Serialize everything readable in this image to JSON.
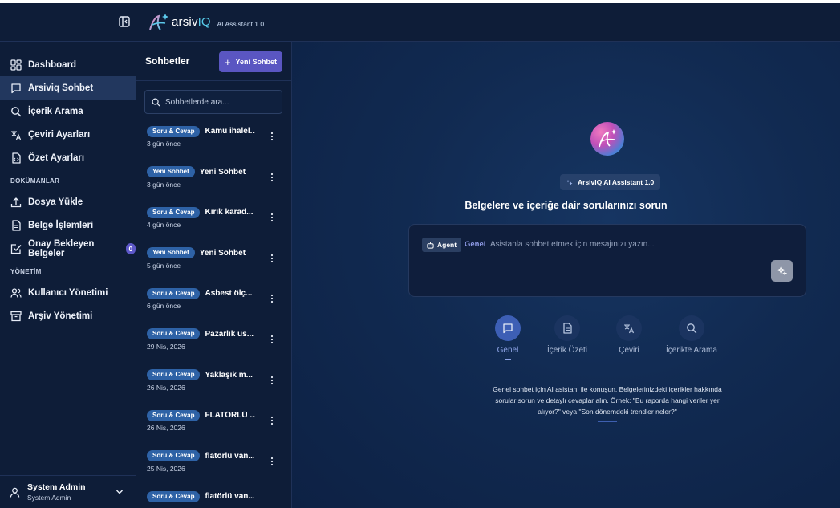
{
  "header": {
    "logo_word": "arsiv",
    "logo_iq": "IQ",
    "subtitle": "AI Assistant 1.0"
  },
  "sidebar": {
    "items": [
      {
        "label": "Dashboard",
        "icon": "dashboard-icon"
      },
      {
        "label": "Arsiviq Sohbet",
        "icon": "chat-icon",
        "active": true
      },
      {
        "label": "İçerik Arama",
        "icon": "search-icon"
      },
      {
        "label": "Çeviri Ayarları",
        "icon": "translate-icon"
      },
      {
        "label": "Özet Ayarları",
        "icon": "summary-icon"
      }
    ],
    "section_docs": "DOKÜMANLAR",
    "doc_items": [
      {
        "label": "Dosya Yükle",
        "icon": "upload-icon"
      },
      {
        "label": "Belge İşlemleri",
        "icon": "document-icon"
      },
      {
        "label": "Onay Bekleyen Belgeler",
        "icon": "approval-icon",
        "badge": "0"
      }
    ],
    "section_admin": "YÖNETİM",
    "admin_items": [
      {
        "label": "Kullanıcı Yönetimi",
        "icon": "users-icon"
      },
      {
        "label": "Arşiv Yönetimi",
        "icon": "archive-icon"
      }
    ],
    "user": {
      "name": "System Admin",
      "role": "System Admin"
    }
  },
  "chats": {
    "title": "Sohbetler",
    "new_label": "Yeni Sohbet",
    "search_placeholder": "Sohbetlerde ara...",
    "items": [
      {
        "tag": "Soru & Cevap",
        "title": "Kamu ihalel...",
        "date": "3 gün önce"
      },
      {
        "tag": "Yeni Sohbet",
        "title": "Yeni Sohbet",
        "date": "3 gün önce"
      },
      {
        "tag": "Soru & Cevap",
        "title": "Kırık karad...",
        "date": "4 gün önce"
      },
      {
        "tag": "Yeni Sohbet",
        "title": "Yeni Sohbet",
        "date": "5 gün önce"
      },
      {
        "tag": "Soru & Cevap",
        "title": "Asbest ölç...",
        "date": "6 gün önce"
      },
      {
        "tag": "Soru & Cevap",
        "title": "Pazarlık us...",
        "date": "29 Nis, 2026"
      },
      {
        "tag": "Soru & Cevap",
        "title": "Yaklaşık m...",
        "date": "26 Nis, 2026"
      },
      {
        "tag": "Soru & Cevap",
        "title": "FLATÖRLÜ ...",
        "date": "26 Nis, 2026"
      },
      {
        "tag": "Soru & Cevap",
        "title": "flatörlü van...",
        "date": "25 Nis, 2026"
      },
      {
        "tag": "Soru & Cevap",
        "title": "flatörlü van...",
        "date": ""
      }
    ]
  },
  "main": {
    "model_badge": "ArsivIQ AI Assistant 1.0",
    "title": "Belgelere ve içeriğe dair sorularınızı sorun",
    "agent_label": "Agent",
    "mode_label": "Genel",
    "prompt_placeholder": "Asistanla sohbet etmek için mesajınızı yazın...",
    "modes": [
      {
        "label": "Genel",
        "icon": "chat-icon",
        "active": true
      },
      {
        "label": "İçerik Özeti",
        "icon": "document-icon"
      },
      {
        "label": "Çeviri",
        "icon": "translate-icon"
      },
      {
        "label": "İçerikte Arama",
        "icon": "search-icon"
      }
    ],
    "description": "Genel sohbet için AI asistanı ile konuşun. Belgelerinizdeki içerikler hakkında sorular sorun ve detaylı cevaplar alın. Örnek: \"Bu raporda hangi veriler yer alıyor?\" veya \"Son dönemdeki trendler neler?\""
  },
  "colors": {
    "background": "#0c1b35",
    "accent": "#5a56c2",
    "tag": "#2e62a6"
  }
}
